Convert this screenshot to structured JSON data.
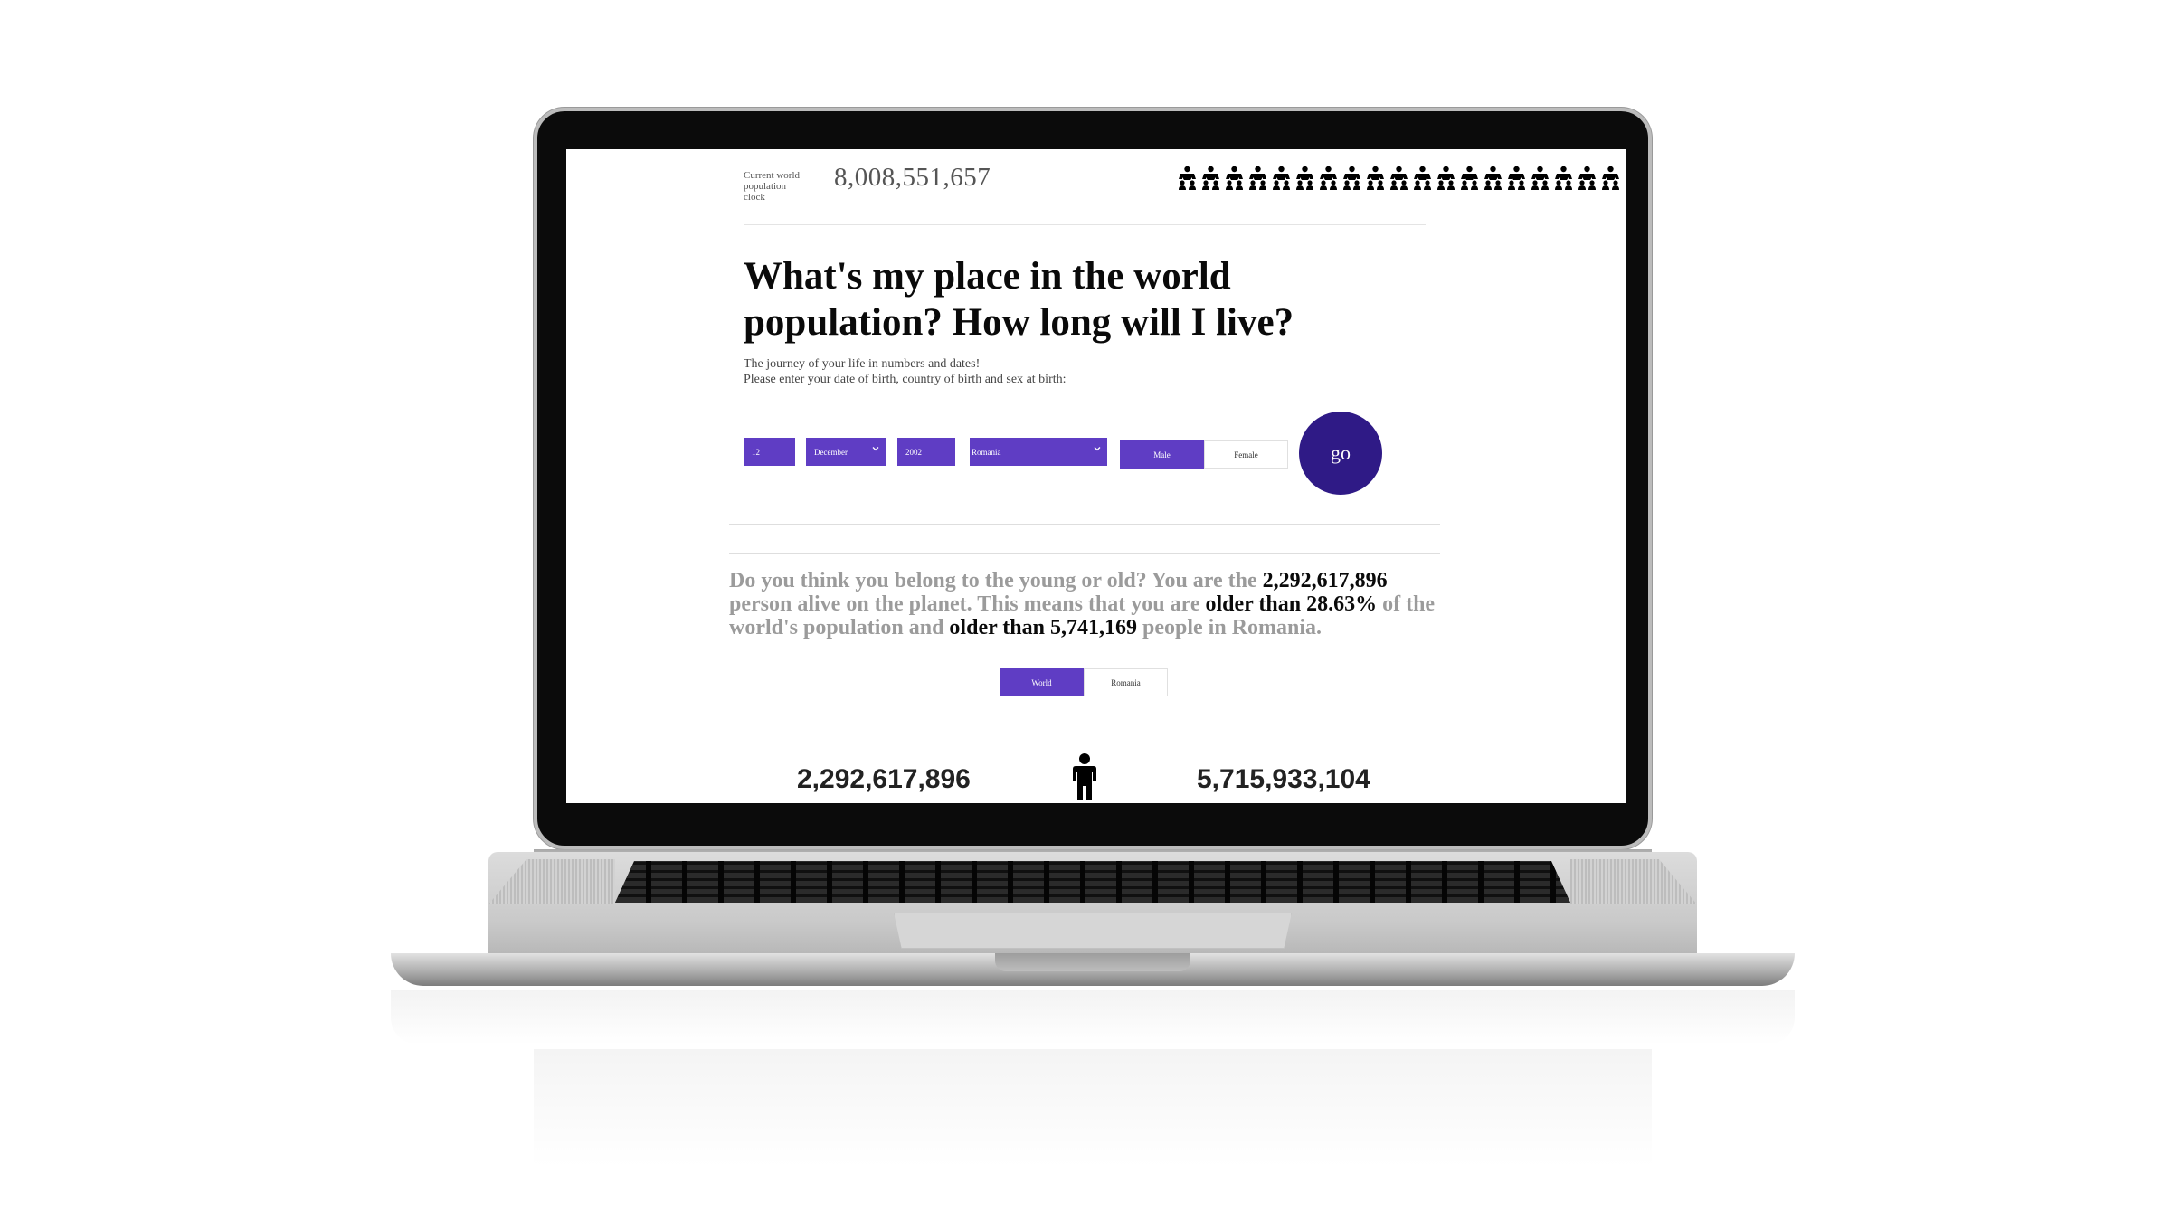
{
  "clock": {
    "label": "Current world population clock",
    "value": "8,008,551,657"
  },
  "headline": "What's my place in the world population? How long will I live?",
  "subtitle": {
    "line1": "The journey of your life in numbers and dates!",
    "line2": "Please enter your date of birth, country of birth and sex at birth:"
  },
  "form": {
    "day": "12",
    "month": "December",
    "year": "2002",
    "country": "Romania",
    "sex_male": "Male",
    "sex_female": "Female",
    "selected_sex": "Male",
    "go_label": "go"
  },
  "result": {
    "part1": "Do you think you belong to the young or old? You are the ",
    "rank": "2,292,617,896",
    "part2": " person alive on the planet. This means that you are ",
    "older_than_label": "older than",
    "world_percent": "28.63%",
    "part3": " of the world's population and ",
    "older_than_label2": "older than",
    "country_count": "5,741,169",
    "part4": " people in ",
    "country_name": "Romania."
  },
  "tabs": {
    "world": "World",
    "romania": "Romania",
    "selected": "World"
  },
  "stats": {
    "younger": "2,292,617,896",
    "older": "5,715,933,104"
  },
  "colors": {
    "accent": "#5f3dc4",
    "go_button": "#2f1a86"
  },
  "icons": {
    "people_row": "person-group-icon",
    "center": "person-icon"
  }
}
